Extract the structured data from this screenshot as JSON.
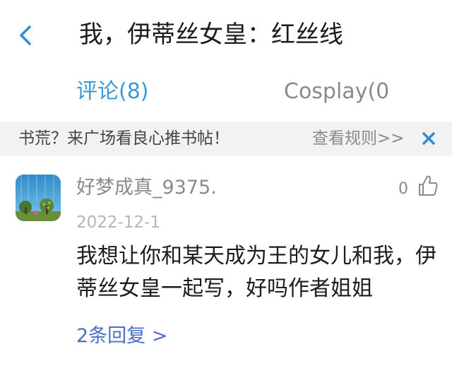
{
  "header": {
    "title": "我，伊蒂丝女皇：红丝线"
  },
  "tabs": [
    {
      "label": "评论(8)",
      "active": true
    },
    {
      "label": "Cosplay(0",
      "active": false
    }
  ],
  "notice": {
    "text": "书荒？来广场看良心推书帖！",
    "link_label": "查看规则>>"
  },
  "comment": {
    "username": "好梦成真_9375.",
    "date": "2022-12-1",
    "like_count": "0",
    "body": "我想让你和某天成为王的女儿和我，伊蒂丝女皇一起写，好吗作者姐姐",
    "replies_label": "2条回复 >"
  },
  "colors": {
    "accent": "#3a9ad9",
    "link": "#4a6fc9",
    "close": "#2f8fd6"
  }
}
